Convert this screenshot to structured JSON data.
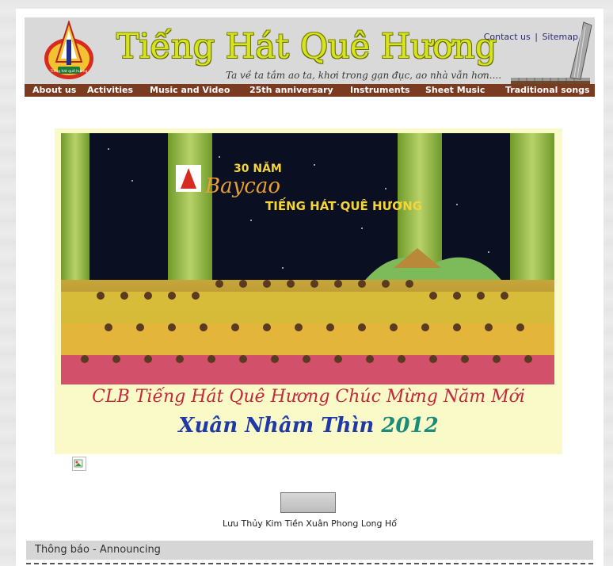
{
  "header": {
    "title": "Tiếng Hát Quê Hương",
    "slogan": "Ta về ta tắm ao ta, khơi trong gạn đục, ao nhà vẫn hơn....",
    "contact_label": "Contact us",
    "separator": "|",
    "sitemap_label": "Sitemap",
    "logo_text": "Tiếng hát quê hương"
  },
  "nav": {
    "items": [
      {
        "label": "About us"
      },
      {
        "label": "Activities"
      },
      {
        "label": "Music and Video"
      },
      {
        "label": "25th anniversary"
      },
      {
        "label": "Instruments"
      },
      {
        "label": "Sheet Music"
      },
      {
        "label": "Traditional songs"
      }
    ]
  },
  "banner": {
    "years": "30 NĂM",
    "script_name": "Baycao",
    "club_name": "TIẾNG HÁT QUÊ HƯƠNG",
    "greeting": "CLB Tiếng Hát Quê Hương Chúc Mừng Năm Mới",
    "year_words": "Xuân Nhâm Thìn",
    "year_number": "2012"
  },
  "player": {
    "song_title": "Lưu Thủy Kim Tiền Xuân Phong Long Hổ"
  },
  "announcements": {
    "title": "Thông báo - Announcing"
  },
  "colors": {
    "nav_bg": "#7a3b20",
    "header_bg": "#d9d9d9",
    "title_color": "#d7e321",
    "banner_bg": "#fafac8",
    "greeting_color": "#c3283c"
  }
}
